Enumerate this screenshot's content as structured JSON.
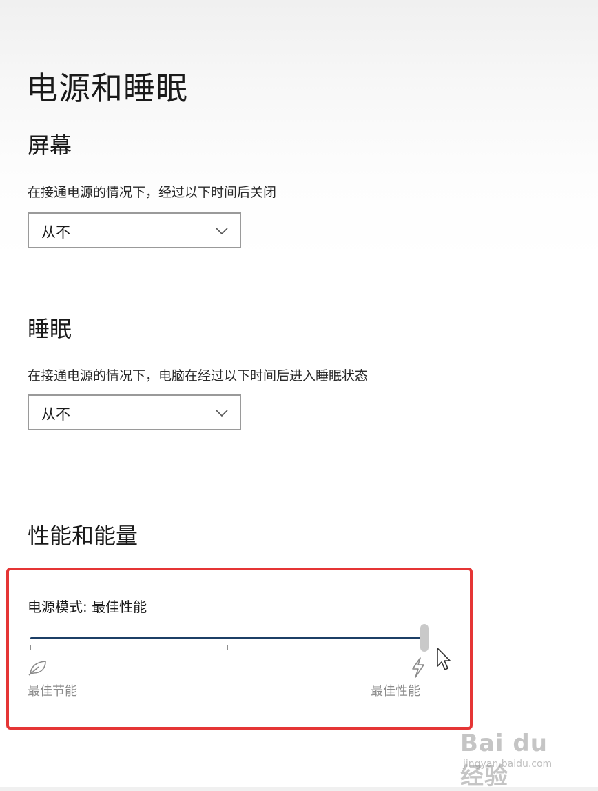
{
  "page": {
    "title": "电源和睡眠"
  },
  "screen": {
    "heading": "屏幕",
    "description": "在接通电源的情况下，经过以下时间后关闭",
    "dropdown_value": "从不"
  },
  "sleep": {
    "heading": "睡眠",
    "description": "在接通电源的情况下，电脑在经过以下时间后进入睡眠状态",
    "dropdown_value": "从不"
  },
  "performance": {
    "heading": "性能和能量",
    "power_mode_label": "电源模式: 最佳性能",
    "slider": {
      "value_fraction": 1.0,
      "tick_count": 3,
      "left_label": "最佳节能",
      "right_label": "最佳性能",
      "left_icon": "leaf-icon",
      "right_icon": "bolt-icon"
    }
  },
  "annotation": {
    "highlight_color": "#e53535"
  },
  "watermark": {
    "logo": "Bai du 经验",
    "url": "jingyan.baidu.com"
  },
  "colors": {
    "slider_fill": "#1c3f66",
    "slider_thumb": "#c9c9c9"
  }
}
